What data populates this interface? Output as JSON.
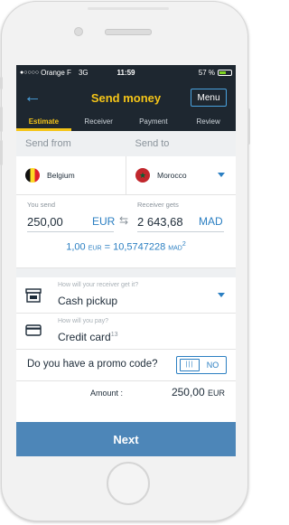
{
  "status_bar": {
    "carrier": "Orange F",
    "network": "3G",
    "time": "11:59",
    "battery_text": "57 %"
  },
  "header": {
    "title": "Send money",
    "menu_label": "Menu",
    "back_icon": "arrow-left-icon"
  },
  "tabs": [
    {
      "label": "Estimate",
      "active": true
    },
    {
      "label": "Receiver",
      "active": false
    },
    {
      "label": "Payment",
      "active": false
    },
    {
      "label": "Review",
      "active": false
    }
  ],
  "send": {
    "from_label": "Send from",
    "to_label": "Send to",
    "from_country": "Belgium",
    "to_country": "Morocco"
  },
  "amounts": {
    "you_send_label": "You send",
    "you_send_value": "250,00",
    "you_send_currency": "EUR",
    "receiver_gets_label": "Receiver gets",
    "receiver_gets_value": "2 643,68",
    "receiver_gets_currency": "MAD",
    "rate_left": "1,00",
    "rate_left_currency": "EUR",
    "rate_equals": "=",
    "rate_right": "10,5747228",
    "rate_right_currency": "MAD",
    "rate_note": "2"
  },
  "delivery": {
    "label": "How will your receiver get it?",
    "value": "Cash pickup",
    "icon": "storefront-icon"
  },
  "payment": {
    "label": "How will you pay?",
    "value": "Credit card",
    "note": "13",
    "icon": "credit-card-icon"
  },
  "promo": {
    "question": "Do you have a promo code?",
    "knob_text": "|||",
    "toggle_text": "NO"
  },
  "total": {
    "label": "Amount :",
    "value": "250,00",
    "currency": "EUR"
  },
  "next_label": "Next",
  "colors": {
    "header_bg": "#1e2730",
    "accent_yellow": "#f5c518",
    "accent_blue": "#2b7fc2",
    "next_button": "#4d86b8"
  }
}
